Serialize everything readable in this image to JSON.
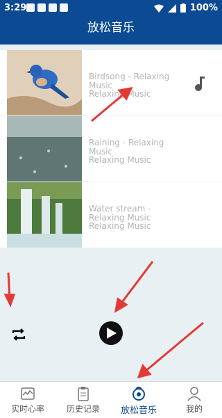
{
  "status": {
    "time": "3:29",
    "battery": "100%"
  },
  "app": {
    "title": "放松音乐"
  },
  "tracks": [
    {
      "name": "Birdsong - Relaxing Music",
      "artist": "Relaxing Music"
    },
    {
      "name": "Raining - Relaxing Music",
      "artist": "Relaxing Music"
    },
    {
      "name": "Water stream - Relaxing Music",
      "artist": "Relaxing Music"
    }
  ],
  "nav": [
    {
      "label": "实时心率",
      "icon": "heart-rate-icon"
    },
    {
      "label": "历史记录",
      "icon": "clipboard-icon"
    },
    {
      "label": "放松音乐",
      "icon": "music-relax-icon",
      "active": true
    },
    {
      "label": "我的",
      "icon": "profile-icon"
    }
  ],
  "colors": {
    "primary": "#0c4b93",
    "background": "#e8f0f3",
    "text_muted": "#b4b4b4",
    "annotation": "#e53935"
  }
}
